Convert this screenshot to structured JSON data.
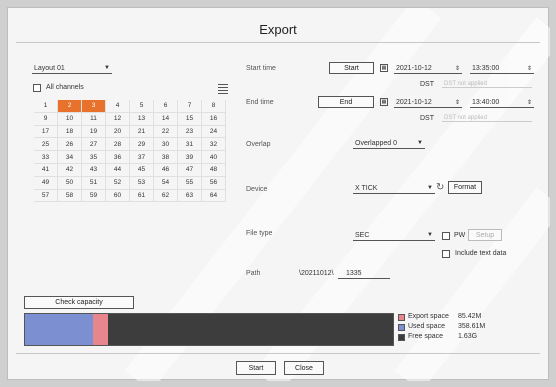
{
  "dialog": {
    "title": "Export"
  },
  "layout_select": {
    "value": "Layout 01"
  },
  "all_channels_label": "All channels",
  "channels": [
    {
      "n": "1",
      "sel": false
    },
    {
      "n": "2",
      "sel": true
    },
    {
      "n": "3",
      "sel": true
    },
    {
      "n": "4",
      "sel": false
    },
    {
      "n": "5",
      "sel": false
    },
    {
      "n": "6",
      "sel": false
    },
    {
      "n": "7",
      "sel": false
    },
    {
      "n": "8",
      "sel": false
    },
    {
      "n": "9",
      "sel": false
    },
    {
      "n": "10",
      "sel": false
    },
    {
      "n": "11",
      "sel": false
    },
    {
      "n": "12",
      "sel": false
    },
    {
      "n": "13",
      "sel": false
    },
    {
      "n": "14",
      "sel": false
    },
    {
      "n": "15",
      "sel": false
    },
    {
      "n": "16",
      "sel": false
    },
    {
      "n": "17",
      "sel": false
    },
    {
      "n": "18",
      "sel": false
    },
    {
      "n": "19",
      "sel": false
    },
    {
      "n": "20",
      "sel": false
    },
    {
      "n": "21",
      "sel": false
    },
    {
      "n": "22",
      "sel": false
    },
    {
      "n": "23",
      "sel": false
    },
    {
      "n": "24",
      "sel": false
    },
    {
      "n": "25",
      "sel": false
    },
    {
      "n": "26",
      "sel": false
    },
    {
      "n": "27",
      "sel": false
    },
    {
      "n": "28",
      "sel": false
    },
    {
      "n": "29",
      "sel": false
    },
    {
      "n": "30",
      "sel": false
    },
    {
      "n": "31",
      "sel": false
    },
    {
      "n": "32",
      "sel": false
    },
    {
      "n": "33",
      "sel": false
    },
    {
      "n": "34",
      "sel": false
    },
    {
      "n": "35",
      "sel": false
    },
    {
      "n": "36",
      "sel": false
    },
    {
      "n": "37",
      "sel": false
    },
    {
      "n": "38",
      "sel": false
    },
    {
      "n": "39",
      "sel": false
    },
    {
      "n": "40",
      "sel": false
    },
    {
      "n": "41",
      "sel": false
    },
    {
      "n": "42",
      "sel": false
    },
    {
      "n": "43",
      "sel": false
    },
    {
      "n": "44",
      "sel": false
    },
    {
      "n": "45",
      "sel": false
    },
    {
      "n": "46",
      "sel": false
    },
    {
      "n": "47",
      "sel": false
    },
    {
      "n": "48",
      "sel": false
    },
    {
      "n": "49",
      "sel": false
    },
    {
      "n": "50",
      "sel": false
    },
    {
      "n": "51",
      "sel": false
    },
    {
      "n": "52",
      "sel": false
    },
    {
      "n": "53",
      "sel": false
    },
    {
      "n": "54",
      "sel": false
    },
    {
      "n": "55",
      "sel": false
    },
    {
      "n": "56",
      "sel": false
    },
    {
      "n": "57",
      "sel": false
    },
    {
      "n": "58",
      "sel": false
    },
    {
      "n": "59",
      "sel": false
    },
    {
      "n": "60",
      "sel": false
    },
    {
      "n": "61",
      "sel": false
    },
    {
      "n": "62",
      "sel": false
    },
    {
      "n": "63",
      "sel": false
    },
    {
      "n": "64",
      "sel": false
    }
  ],
  "labels": {
    "start_time": "Start time",
    "end_time": "End time",
    "overlap": "Overlap",
    "device": "Device",
    "file_type": "File type",
    "path": "Path"
  },
  "start": {
    "button": "Start",
    "date": "2021-10-12",
    "time": "13:35:00",
    "dst_label": "DST",
    "dst_value": "DST not applied"
  },
  "end": {
    "button": "End",
    "date": "2021-10-12",
    "time": "13:40:00",
    "dst_label": "DST",
    "dst_value": "DST not applied"
  },
  "overlap_select": {
    "value": "Overlapped 0"
  },
  "device_select": {
    "value": "X TICK"
  },
  "format_button": "Format",
  "file_type_select": {
    "value": "SEC"
  },
  "pw_label": "PW",
  "setup_button": "Setup",
  "include_text_label": "Include text data",
  "path": {
    "prefix": "\\20211012\\",
    "value": "1335"
  },
  "check_capacity_button": "Check capacity",
  "capacity": {
    "used_fraction": 0.185,
    "export_fraction": 0.04,
    "legend": [
      {
        "label": "Export space",
        "value": "85.42M",
        "color": "#e7868c"
      },
      {
        "label": "Used space",
        "value": "358.61M",
        "color": "#7b8fd1"
      },
      {
        "label": "Free space",
        "value": "1.63G",
        "color": "#3d3d3d"
      }
    ]
  },
  "footer": {
    "start_button": "Start",
    "close_button": "Close"
  }
}
